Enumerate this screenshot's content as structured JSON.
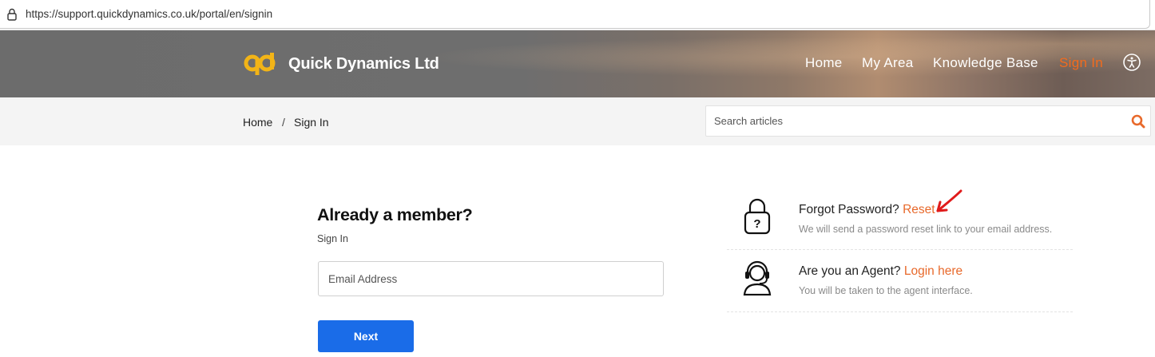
{
  "browser": {
    "url": "https://support.quickdynamics.co.uk/portal/en/signin"
  },
  "header": {
    "brand": "Quick Dynamics Ltd",
    "nav": [
      "Home",
      "My Area",
      "Knowledge Base",
      "Sign In"
    ],
    "active_nav": "Sign In",
    "accent_color": "#f26b1d"
  },
  "breadcrumb": {
    "home": "Home",
    "separator": "/",
    "current": "Sign In"
  },
  "search": {
    "placeholder": "Search articles"
  },
  "signin": {
    "title": "Already a member?",
    "subtitle": "Sign In",
    "email_placeholder": "Email Address",
    "email_value": "",
    "next_label": "Next",
    "button_color": "#1a6ce8"
  },
  "options": {
    "forgot": {
      "prefix": "Forgot Password?",
      "link": "Reset",
      "desc": "We will send a password reset link to your email address."
    },
    "agent": {
      "prefix": "Are you an Agent?",
      "link": "Login here",
      "desc": "You will be taken to the agent interface."
    }
  },
  "icons": [
    "lock-icon",
    "logo-icon",
    "accessibility-icon",
    "search-icon",
    "padlock-question-icon",
    "headset-agent-icon",
    "red-arrow-annotation"
  ]
}
